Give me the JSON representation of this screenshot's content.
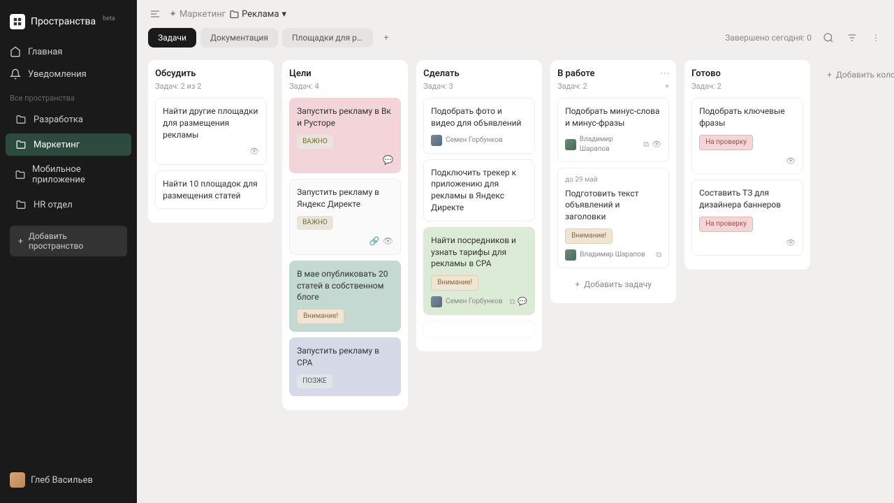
{
  "logo": {
    "title": "Пространства",
    "beta": "beta"
  },
  "nav": {
    "home": "Главная",
    "notifications": "Уведомления"
  },
  "spaces": {
    "label": "Все пространства",
    "items": [
      {
        "name": "Разработка",
        "active": false
      },
      {
        "name": "Маркетинг",
        "active": true
      },
      {
        "name": "Мобильное приложение",
        "active": false
      },
      {
        "name": "HR отдел",
        "active": false
      }
    ],
    "add_btn": "Добавить пространство"
  },
  "user": {
    "name": "Глеб Васильев"
  },
  "breadcrumb": {
    "parent": "Маркетинг",
    "current": "Реклама"
  },
  "tabs": {
    "items": [
      {
        "label": "Задачи",
        "active": true
      },
      {
        "label": "Документация",
        "active": false
      },
      {
        "label": "Площадки для размеще...",
        "active": false
      }
    ]
  },
  "status_text": "Завершено сегодня: 0",
  "board": {
    "add_column": "Добавить колонку",
    "columns": [
      {
        "title": "Обсудить",
        "count": "Задач: 2 из 2",
        "cards": [
          {
            "title": "Найти другие площадки для размещения рекламы",
            "show_eye": true
          },
          {
            "title": "Найти 10 площадок для размещения статей"
          }
        ]
      },
      {
        "title": "Цели",
        "count": "Задач: 4",
        "cards": [
          {
            "title": "Запустить рекламу в Вк и Русторе",
            "tag": "ВАЖНО",
            "tag_type": "important",
            "color": "pink",
            "footer_icons": true
          },
          {
            "title": "Запустить рекламу в Яндекс Директе",
            "tag": "ВАЖНО",
            "tag_type": "important",
            "footer_icons_double": true
          },
          {
            "title": "В мае опубликовать 20 статей в собственном блоге",
            "tag": "Внимание!",
            "tag_type": "attention",
            "color": "teal"
          },
          {
            "title": "Запустить рекламу в СРА",
            "tag": "ПОЗЖЕ",
            "tag_type": "later",
            "color": "blue"
          }
        ]
      },
      {
        "title": "Сделать",
        "count": "Задач: 3",
        "cards": [
          {
            "title": "Подобрать фото и видео для объявлений",
            "assignee": "Семен Горбунков",
            "avatar": "semen"
          },
          {
            "title": "Подключить трекер к приложению для рекламы в Яндекс Директе"
          },
          {
            "title": "Найти посредников и узнать тарифы для рекламы в СРА",
            "tag": "Внимание!",
            "tag_type": "attention",
            "color": "green",
            "assignee": "Семен Горбунков",
            "avatar": "semen",
            "card_icons": true
          }
        ],
        "ghost": true
      },
      {
        "title": "В работе",
        "count": "Задач: 2",
        "show_actions": true,
        "cards": [
          {
            "title": "Подобрать минус-слова и минус-фразы",
            "assignee": "Владимир Шарапов",
            "avatar": "vlad",
            "card_icons_eye": true
          },
          {
            "due": "до 29 май",
            "title": "Подготовить текст объявлений и заголовки",
            "tag": "Внимание!",
            "tag_type": "attention",
            "assignee": "Владимир Шарапов",
            "avatar": "vlad",
            "card_icons_single": true
          }
        ],
        "add_task": "Добавить задачу"
      },
      {
        "title": "Готово",
        "count": "Задач: 2",
        "cards": [
          {
            "title": "Подобрать ключевые фразы",
            "tag": "На проверку",
            "tag_type": "review",
            "show_eye_bottom": true
          },
          {
            "title": "Составить ТЗ для дизайнера баннеров",
            "tag": "На проверку",
            "tag_type": "review",
            "show_eye_bottom": true
          }
        ]
      }
    ]
  }
}
